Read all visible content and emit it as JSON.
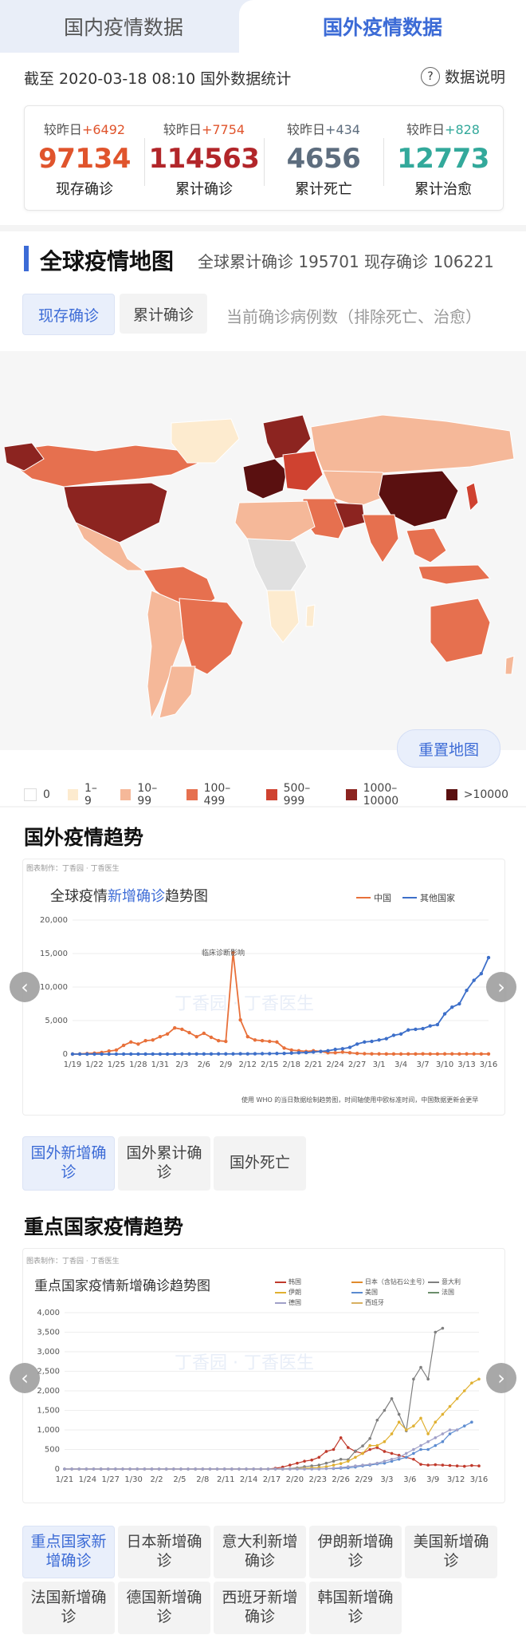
{
  "tabs": {
    "domestic": "国内疫情数据",
    "foreign": "国外疫情数据"
  },
  "info": {
    "timestamp": "截至 2020-03-18 08:10 国外数据统计",
    "help": "数据说明"
  },
  "stats": [
    {
      "compare_label": "较昨日",
      "delta": "+6492",
      "value": "97134",
      "label": "现存确诊",
      "color": "#e0542c",
      "delta_color": "#e0542c"
    },
    {
      "compare_label": "较昨日",
      "delta": "+7754",
      "value": "114563",
      "label": "累计确诊",
      "color": "#b2262a",
      "delta_color": "#e0542c"
    },
    {
      "compare_label": "较昨日",
      "delta": "+434",
      "value": "4656",
      "label": "累计死亡",
      "color": "#5d6d7e",
      "delta_color": "#5d6d7e"
    },
    {
      "compare_label": "较昨日",
      "delta": "+828",
      "value": "12773",
      "label": "累计治愈",
      "color": "#33a99b",
      "delta_color": "#33a99b"
    }
  ],
  "map": {
    "title": "全球疫情地图",
    "summary": "全球累计确诊 195701   现存确诊 106221",
    "btn_current": "现存确诊",
    "btn_total": "累计确诊",
    "note": "当前确诊病例数（排除死亡、治愈）",
    "reset": "重置地图",
    "legend": [
      {
        "label": "0",
        "color": "#ffffff"
      },
      {
        "label": "1–9",
        "color": "#fdebcf"
      },
      {
        "label": "10–99",
        "color": "#f5b899"
      },
      {
        "label": "100–499",
        "color": "#e6704f"
      },
      {
        "label": "500–999",
        "color": "#cf4230"
      },
      {
        "label": "1000–10000",
        "color": "#8c2420"
      },
      {
        "label": ">10000",
        "color": "#5a1010"
      }
    ]
  },
  "trend": {
    "section_title": "国外疫情趋势",
    "credit": "图表制作：丁香园 · 丁香医生",
    "title_pre": "全球疫情",
    "title_hl": "新增确诊",
    "title_post": "趋势图",
    "legend_china": "中国",
    "legend_other": "其他国家",
    "annotation": "临床诊断影响",
    "footnote": "使用 WHO 的当日数据绘制趋势图，时间轴使用中欧标准时间，中国数据更新会更早",
    "watermark": "丁香园 · 丁香医生",
    "buttons": [
      "国外新增确诊",
      "国外累计确诊",
      "国外死亡"
    ]
  },
  "key": {
    "section_title": "重点国家疫情趋势",
    "credit": "图表制作：丁香园 · 丁香医生",
    "title": "重点国家疫情新增确诊趋势图",
    "legend": [
      {
        "name": "韩国",
        "color": "#c0392b"
      },
      {
        "name": "日本（含钻石公主号）",
        "color": "#e08a2c"
      },
      {
        "name": "意大利",
        "color": "#7f7f7f"
      },
      {
        "name": "伊朗",
        "color": "#e0b030"
      },
      {
        "name": "美国",
        "color": "#5b8bd0"
      },
      {
        "name": "法国",
        "color": "#6b8e6b"
      },
      {
        "name": "德国",
        "color": "#a0a0c8"
      },
      {
        "name": "西班牙",
        "color": "#d8b060"
      }
    ],
    "buttons": [
      "重点国家新增确诊",
      "日本新增确诊",
      "意大利新增确诊",
      "伊朗新增确诊",
      "美国新增确诊",
      "法国新增确诊",
      "德国新增确诊",
      "西班牙新增确诊",
      "韩国新增确诊"
    ]
  },
  "chart_data": [
    {
      "type": "line",
      "title": "全球疫情新增确诊趋势图",
      "x_ticks": [
        "1/19",
        "1/22",
        "1/25",
        "1/28",
        "1/31",
        "2/3",
        "2/6",
        "2/9",
        "2/12",
        "2/15",
        "2/18",
        "2/21",
        "2/24",
        "2/27",
        "3/1",
        "3/4",
        "3/7",
        "3/10",
        "3/13",
        "3/16"
      ],
      "ylim": [
        0,
        20000
      ],
      "y_ticks": [
        "0",
        "5,000",
        "10,000",
        "15,000",
        "20,000"
      ],
      "series": [
        {
          "name": "中国",
          "color": "#e8703a",
          "values": [
            0,
            20,
            80,
            140,
            250,
            450,
            600,
            1300,
            1800,
            1500,
            2000,
            2100,
            2600,
            3000,
            3900,
            3700,
            3200,
            2600,
            3100,
            2500,
            2000,
            1900,
            15150,
            5100,
            2600,
            2100,
            2000,
            1900,
            1800,
            900,
            600,
            500,
            400,
            500,
            400,
            200,
            200,
            300,
            200,
            100,
            60,
            40,
            30,
            20,
            20,
            15,
            20,
            25,
            40,
            20,
            20,
            30,
            30,
            20,
            30,
            30,
            20,
            25
          ]
        },
        {
          "name": "其他国家",
          "color": "#3d6fc9",
          "values": [
            0,
            0,
            0,
            0,
            0,
            0,
            0,
            10,
            10,
            10,
            10,
            10,
            10,
            10,
            10,
            20,
            20,
            20,
            20,
            20,
            30,
            30,
            30,
            50,
            40,
            50,
            60,
            70,
            90,
            100,
            150,
            200,
            230,
            300,
            400,
            500,
            700,
            800,
            1000,
            1500,
            1800,
            1900,
            2100,
            2300,
            2800,
            3000,
            3600,
            3700,
            3800,
            4200,
            4400,
            6000,
            7000,
            7500,
            9500,
            11000,
            12000,
            14400
          ]
        }
      ]
    },
    {
      "type": "line",
      "title": "重点国家疫情新增确诊趋势图",
      "x_ticks": [
        "1/21",
        "1/24",
        "1/27",
        "1/30",
        "2/2",
        "2/5",
        "2/8",
        "2/11",
        "2/14",
        "2/17",
        "2/20",
        "2/23",
        "2/26",
        "2/29",
        "3/3",
        "3/6",
        "3/9",
        "3/12",
        "3/16"
      ],
      "ylim": [
        0,
        4000
      ],
      "y_ticks": [
        "0",
        "500",
        "1,000",
        "1,500",
        "2,000",
        "2,500",
        "3,000",
        "3,500",
        "4,000"
      ],
      "series": [
        {
          "name": "韩国",
          "color": "#c0392b",
          "values": [
            0,
            0,
            0,
            0,
            0,
            0,
            0,
            0,
            0,
            0,
            0,
            0,
            0,
            0,
            0,
            0,
            0,
            0,
            0,
            0,
            0,
            0,
            0,
            0,
            0,
            0,
            0,
            0,
            0,
            20,
            50,
            100,
            150,
            200,
            230,
            300,
            450,
            500,
            800,
            550,
            450,
            400,
            500,
            550,
            450,
            400,
            350,
            300,
            250,
            120,
            100,
            110,
            100,
            90,
            80,
            70,
            90,
            80
          ]
        },
        {
          "name": "意大利",
          "color": "#7f7f7f",
          "values": [
            0,
            0,
            0,
            0,
            0,
            0,
            0,
            0,
            0,
            0,
            0,
            0,
            0,
            0,
            0,
            0,
            0,
            0,
            0,
            0,
            0,
            0,
            0,
            0,
            0,
            0,
            0,
            0,
            0,
            0,
            0,
            10,
            30,
            60,
            80,
            100,
            150,
            200,
            250,
            240,
            460,
            590,
            780,
            1250,
            1500,
            1800,
            1400,
            977,
            2300,
            2600,
            2300,
            3500,
            3600
          ]
        },
        {
          "name": "伊朗",
          "color": "#e0b030",
          "values": [
            0,
            0,
            0,
            0,
            0,
            0,
            0,
            0,
            0,
            0,
            0,
            0,
            0,
            0,
            0,
            0,
            0,
            0,
            0,
            0,
            0,
            0,
            0,
            0,
            0,
            0,
            0,
            0,
            0,
            0,
            0,
            0,
            10,
            20,
            30,
            40,
            60,
            100,
            140,
            200,
            300,
            400,
            600,
            600,
            700,
            900,
            1200,
            1000,
            1100,
            1300,
            900,
            1200,
            1400,
            1600,
            1800,
            2000,
            2200,
            2300
          ]
        },
        {
          "name": "美国",
          "color": "#5b8bd0",
          "values": [
            0,
            0,
            0,
            0,
            0,
            0,
            0,
            0,
            0,
            0,
            0,
            0,
            0,
            0,
            0,
            0,
            0,
            0,
            0,
            0,
            0,
            0,
            0,
            0,
            0,
            0,
            0,
            0,
            0,
            0,
            0,
            0,
            0,
            0,
            0,
            0,
            10,
            10,
            20,
            30,
            50,
            80,
            100,
            130,
            150,
            200,
            250,
            300,
            400,
            500,
            500,
            600,
            700,
            900,
            1000,
            1100,
            1200
          ]
        },
        {
          "name": "德国",
          "color": "#a0a0c8",
          "values": [
            0,
            0,
            0,
            0,
            0,
            0,
            0,
            0,
            0,
            0,
            0,
            0,
            0,
            0,
            0,
            0,
            0,
            0,
            0,
            0,
            0,
            0,
            0,
            0,
            0,
            0,
            0,
            0,
            0,
            0,
            0,
            0,
            0,
            0,
            0,
            0,
            10,
            20,
            40,
            60,
            80,
            100,
            120,
            150,
            200,
            250,
            300,
            400,
            500,
            600,
            700,
            800,
            900,
            1000,
            1000
          ]
        }
      ]
    }
  ]
}
